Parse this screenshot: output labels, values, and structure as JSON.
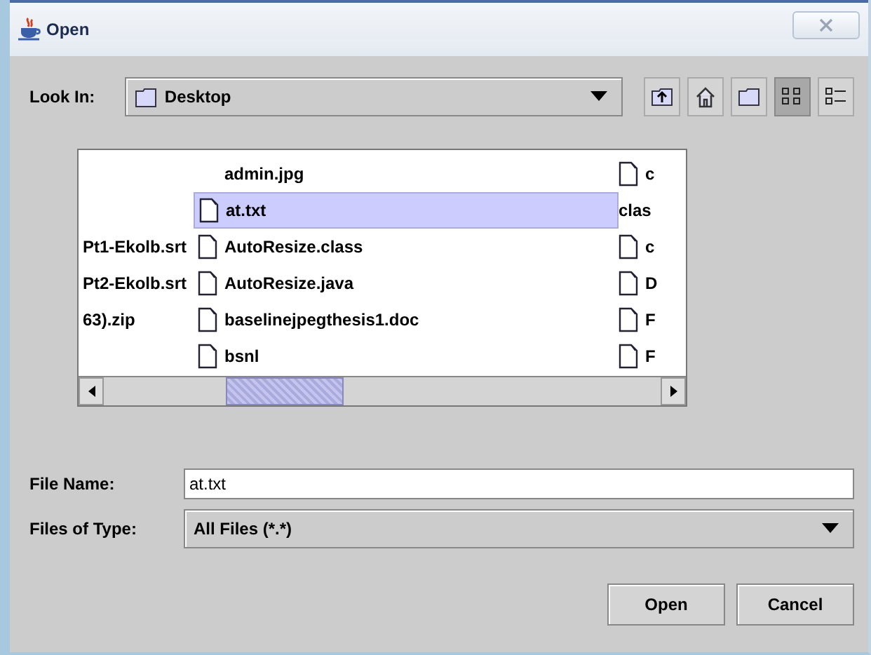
{
  "window": {
    "title": "Open"
  },
  "look_in": {
    "label": "Look In:",
    "value": "Desktop"
  },
  "toolbar": [
    {
      "kind": "up"
    },
    {
      "kind": "home"
    },
    {
      "kind": "new-folder"
    },
    {
      "kind": "list",
      "selected": true
    },
    {
      "kind": "details",
      "selected": false
    }
  ],
  "file_list": {
    "columns": [
      [
        {
          "selected": false
        },
        {
          "selected": false
        },
        {
          "name": "Pt1-Ekolb.srt",
          "selected": false
        },
        {
          "name": "Pt2-Ekolb.srt",
          "selected": false
        },
        {
          "name": "63).zip",
          "selected": false
        }
      ],
      [
        {
          "name": "admin.jpg",
          "icon": false,
          "selected": false
        },
        {
          "name": "at.txt",
          "icon": true,
          "selected": true
        },
        {
          "name": "AutoResize.class",
          "icon": true,
          "selected": false
        },
        {
          "name": "AutoResize.java",
          "icon": true,
          "selected": false
        },
        {
          "name": "baselinejpegthesis1.doc",
          "icon": true,
          "selected": false
        },
        {
          "name": "bsnl",
          "icon": true,
          "selected": false
        }
      ],
      [
        {
          "name": "c",
          "icon": true,
          "selected": false
        },
        {
          "name": "clas",
          "icon": false,
          "selected": false
        },
        {
          "name": "c",
          "icon": true,
          "selected": false
        },
        {
          "name": "D",
          "icon": true,
          "selected": false
        },
        {
          "name": "F",
          "icon": true,
          "selected": false
        },
        {
          "name": "F",
          "icon": true,
          "selected": false
        }
      ]
    ]
  },
  "file_name": {
    "label": "File Name:",
    "value": "at.txt"
  },
  "file_type": {
    "label": "Files of Type:",
    "value": "All Files (*.*)"
  },
  "buttons": [
    "Open",
    "Cancel"
  ]
}
